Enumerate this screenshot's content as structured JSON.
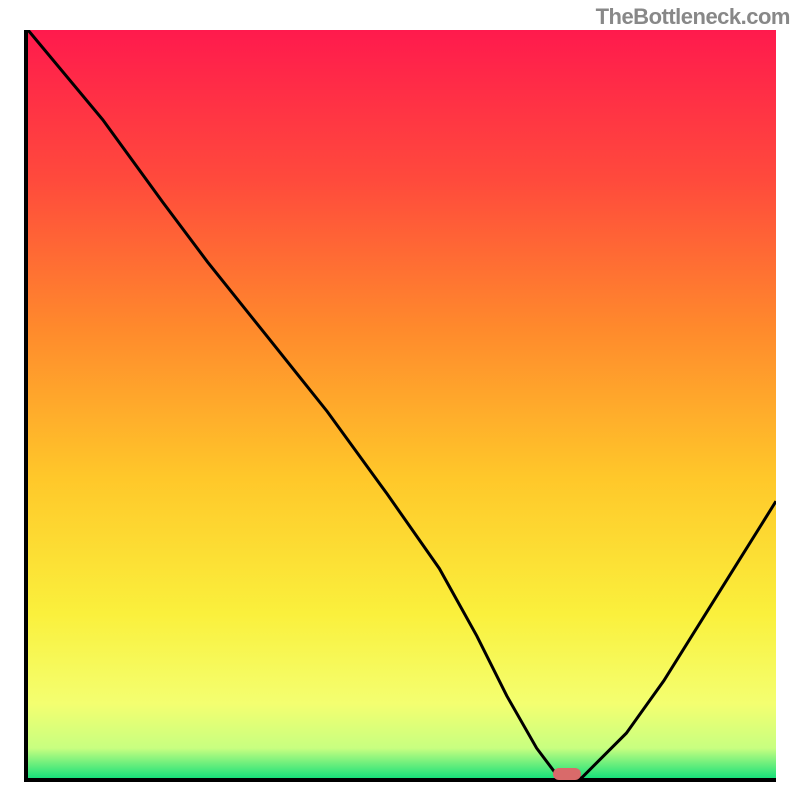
{
  "watermark": "TheBottleneck.com",
  "chart_data": {
    "type": "line",
    "title": "",
    "xlabel": "",
    "ylabel": "",
    "xlim": [
      0,
      100
    ],
    "ylim": [
      0,
      100
    ],
    "gradient_colors": {
      "top": "#ff1a4d",
      "t20": "#ff4a3c",
      "t40": "#ff8a2c",
      "t60": "#ffc82a",
      "t78": "#faf03c",
      "t90": "#f4ff70",
      "t96": "#c8ff80",
      "bottom": "#18e07a"
    },
    "series": [
      {
        "name": "bottleneck-curve",
        "x": [
          0,
          10,
          18,
          24,
          32,
          40,
          48,
          55,
          60,
          64,
          68,
          71,
          74,
          80,
          85,
          90,
          95,
          100
        ],
        "y": [
          100,
          88,
          77,
          69,
          59,
          49,
          38,
          28,
          19,
          11,
          4,
          0,
          0,
          6,
          13,
          21,
          29,
          37
        ]
      }
    ],
    "marker": {
      "x": 72,
      "y": 0,
      "color": "#d96a6a"
    }
  }
}
